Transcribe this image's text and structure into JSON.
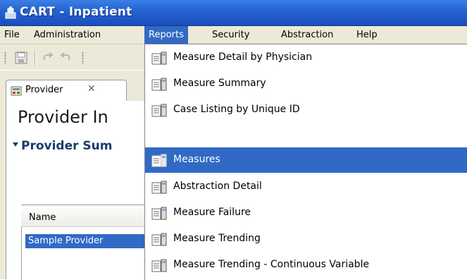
{
  "window": {
    "title": "CART - Inpatient"
  },
  "menubar": {
    "items": [
      {
        "label": "File",
        "active": false
      },
      {
        "label": "Administration",
        "active": false
      },
      {
        "label": "Reports",
        "active": true
      },
      {
        "label": "Security",
        "active": false
      },
      {
        "label": "Abstraction",
        "active": false
      },
      {
        "label": "Help",
        "active": false
      }
    ]
  },
  "toolbar": {
    "icons": [
      "save-icon",
      "undo-icon",
      "redo-icon"
    ]
  },
  "editor": {
    "tab": {
      "label": "Provider",
      "close": "✕"
    },
    "panel_title": "Provider In",
    "section_title": "Provider Sum",
    "table": {
      "columns": [
        "Name"
      ],
      "rows": [
        {
          "name": "Sample Provider",
          "selected": true
        }
      ]
    }
  },
  "reports_menu": {
    "items": [
      {
        "label": "Measure Detail by Physician",
        "highlighted": false
      },
      {
        "label": "Measure Summary",
        "highlighted": false
      },
      {
        "label": "Case Listing by Unique ID",
        "highlighted": false
      },
      {
        "label": "Measures",
        "highlighted": true
      },
      {
        "label": "Abstraction Detail",
        "highlighted": false
      },
      {
        "label": "Measure Failure",
        "highlighted": false
      },
      {
        "label": "Measure Trending",
        "highlighted": false
      },
      {
        "label": "Measure Trending - Continuous Variable",
        "highlighted": false
      }
    ]
  },
  "colors": {
    "titlebar": "#2461d1",
    "menu_highlight": "#316ac5",
    "chrome": "#ece9d8"
  }
}
